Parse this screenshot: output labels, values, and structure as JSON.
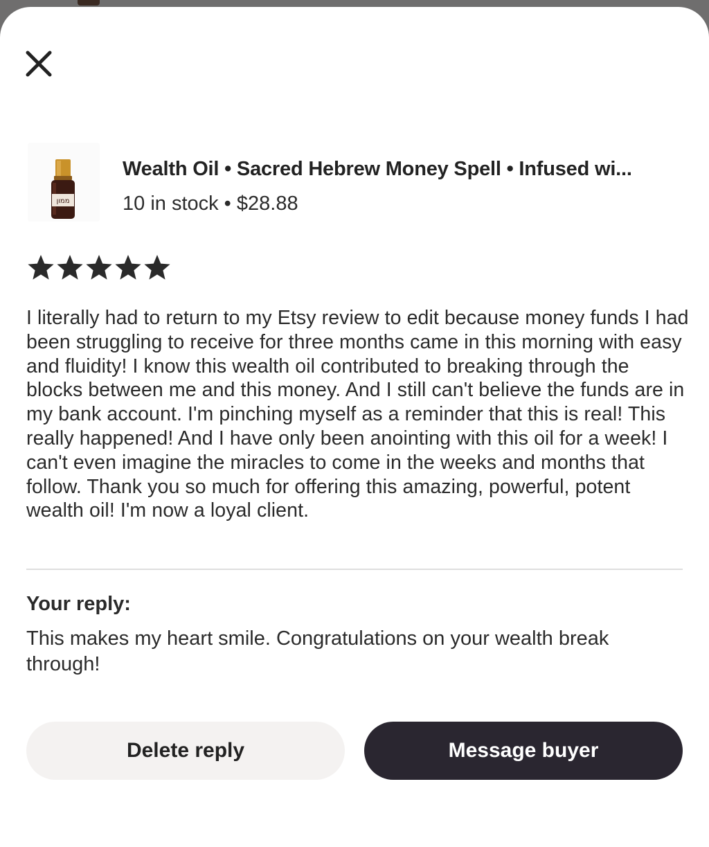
{
  "sheet": {
    "close_icon": "close-icon"
  },
  "product": {
    "title": "Wealth Oil • Sacred Hebrew Money Spell • Infused wi...",
    "meta": "10 in stock • $28.88",
    "thumbnail_label": "ממון"
  },
  "review": {
    "rating": 5,
    "max_rating": 5,
    "star_color": "#2a2a2a",
    "text": "I literally had to return to my Etsy review to edit because money funds I had been struggling to receive for three months came in this morning with easy and fluidity! I know this wealth oil contributed to breaking through the blocks between me and this money. And I still can't believe the funds are in my bank account. I'm pinching myself as a reminder that this is real! This really happened! And I have only been anointing with this oil for a week! I can't even imagine the miracles to come in the weeks and months that follow. Thank you so much for offering this amazing, powerful, potent wealth oil! I'm now a loyal client."
  },
  "reply": {
    "label": "Your reply:",
    "text": "This makes my heart smile. Congratulations on your wealth break through!"
  },
  "actions": {
    "delete_label": "Delete reply",
    "message_label": "Message buyer",
    "primary_color": "#2a2630",
    "secondary_color": "#f4f2f1"
  }
}
